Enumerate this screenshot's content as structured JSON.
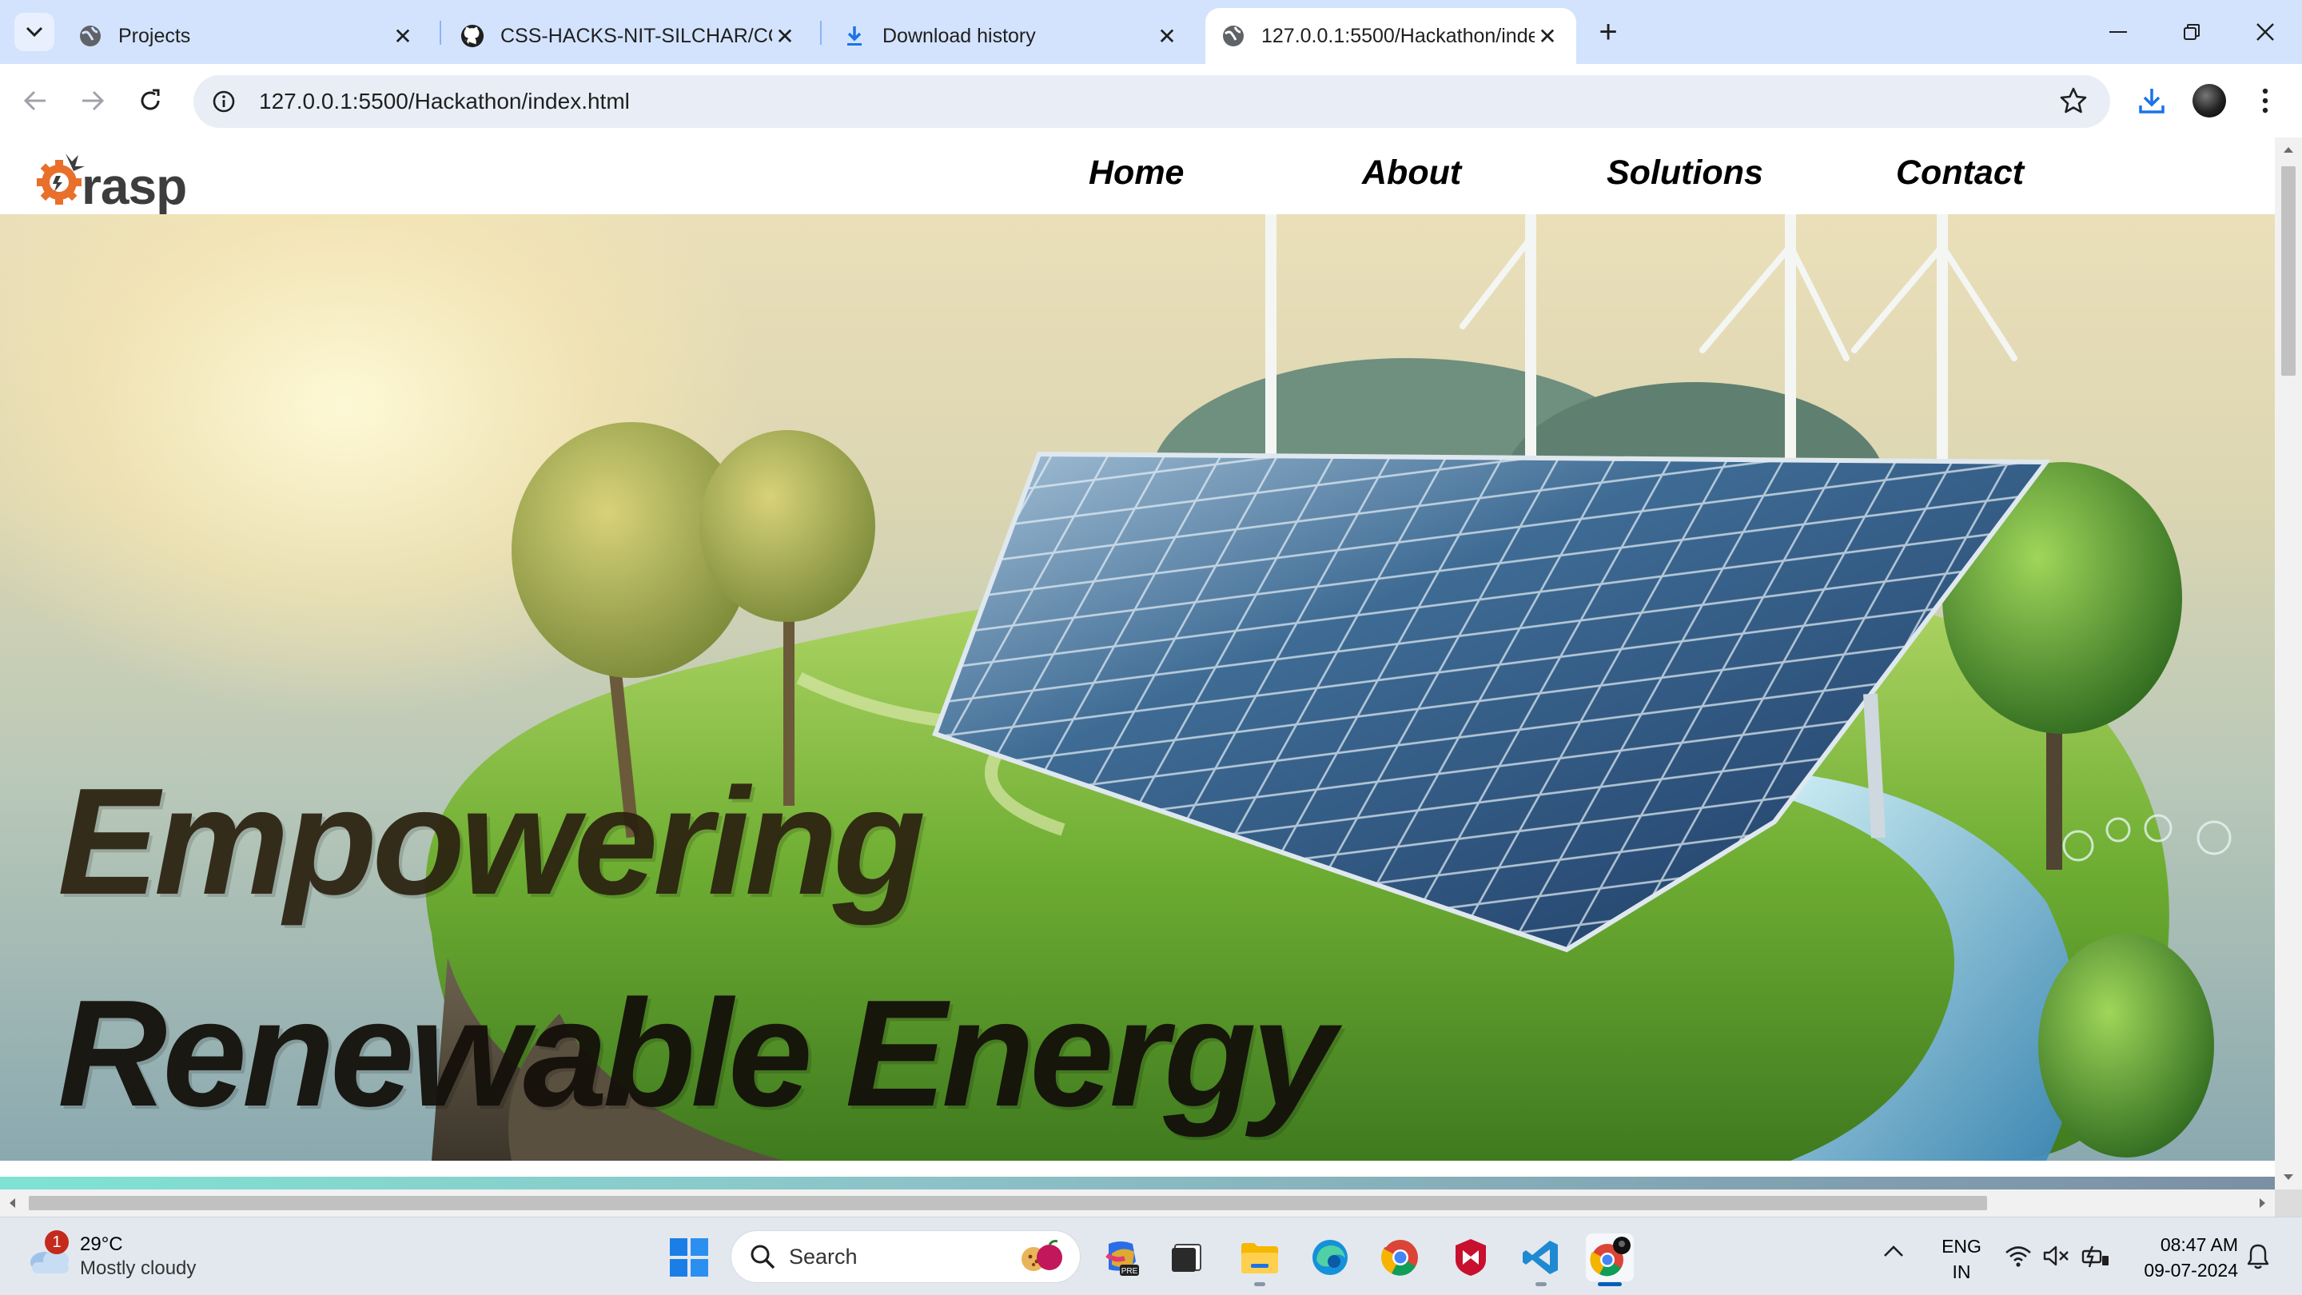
{
  "browser": {
    "tabs": [
      {
        "title": "Projects",
        "active": false,
        "favicon": "globe-icon"
      },
      {
        "title": "CSS-HACKS-NIT-SILCHAR/CCS",
        "active": false,
        "favicon": "github-icon"
      },
      {
        "title": "Download history",
        "active": false,
        "favicon": "download-icon"
      },
      {
        "title": "127.0.0.1:5500/Hackathon/inde",
        "active": true,
        "favicon": "globe-icon"
      }
    ],
    "new_tab": "+",
    "url": "127.0.0.1:5500/Hackathon/index.html",
    "accent_color": "#d3e3fd"
  },
  "site": {
    "logo_text": "rasp",
    "nav": [
      "Home",
      "About",
      "Solutions",
      "Contact"
    ],
    "hero": {
      "headline_line1": "Empowering",
      "headline_line2": "Renewable Energy"
    }
  },
  "taskbar": {
    "weather": {
      "badge": "1",
      "temperature": "29°C",
      "condition": "Mostly cloudy"
    },
    "search_placeholder": "Search",
    "apps": [
      "copilot-icon",
      "terminal-icon",
      "file-explorer-icon",
      "edge-icon",
      "chrome-icon",
      "mcafee-icon",
      "vscode-icon",
      "chrome-profile-icon"
    ],
    "language": {
      "line1": "ENG",
      "line2": "IN"
    },
    "time": "08:47 AM",
    "date": "09-07-2024"
  }
}
